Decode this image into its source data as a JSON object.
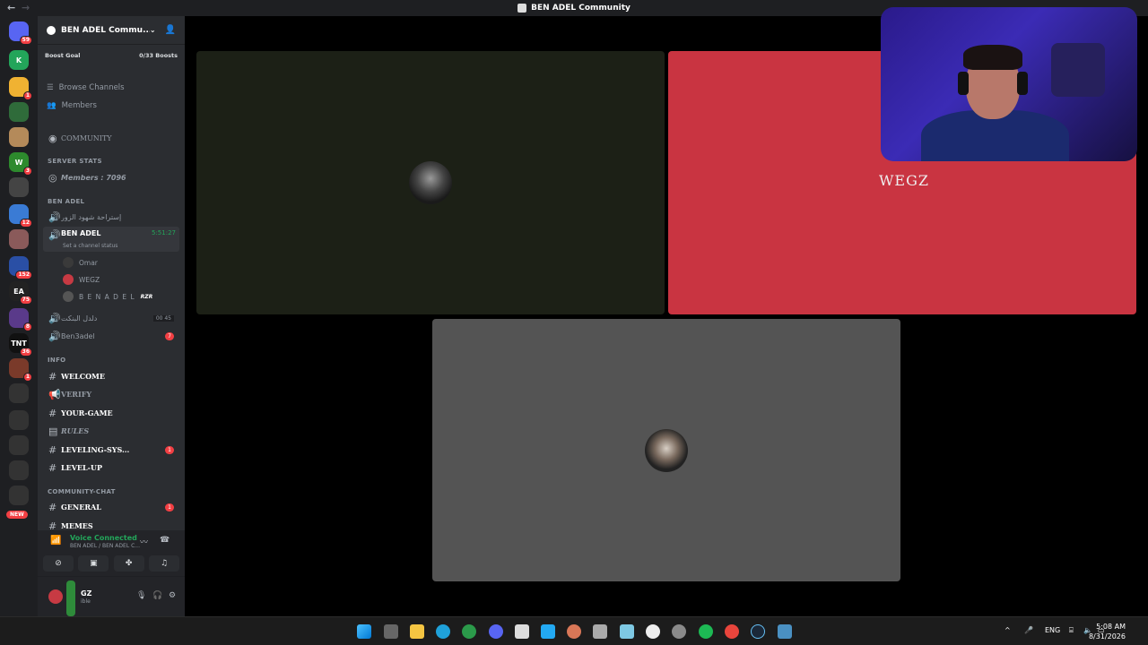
{
  "window": {
    "title": "BEN ADEL Community"
  },
  "rail": {
    "servers": [
      {
        "label": "",
        "color": "#5865f2",
        "badge": "59",
        "icon": "discord-home-icon"
      },
      {
        "label": "K",
        "color": "#23a55a",
        "badge": "",
        "icon": "k-server-icon"
      },
      {
        "label": "",
        "color": "#f0b232",
        "badge": "1",
        "icon": "headphones-server-icon"
      },
      {
        "label": "",
        "color": "#2f6b3a",
        "badge": "",
        "icon": "landscape-server-icon"
      },
      {
        "label": "",
        "color": "#b48a5a",
        "badge": "",
        "icon": "portrait-server-icon"
      },
      {
        "label": "W",
        "color": "#2d8a2d",
        "badge": "3",
        "icon": "w-server-icon"
      },
      {
        "label": "",
        "color": "#444",
        "badge": "",
        "icon": "arabic-server-icon"
      },
      {
        "label": "",
        "color": "#3a7bd5",
        "badge": "12",
        "icon": "fps-server-icon"
      },
      {
        "label": "",
        "color": "#8a5a5a",
        "badge": "",
        "icon": "collage-server-icon"
      },
      {
        "label": "",
        "color": "#2a4fa5",
        "badge": "152",
        "icon": "avatar-server-icon"
      },
      {
        "label": "EA",
        "color": "#222",
        "badge": "75",
        "icon": "ea-server-icon"
      },
      {
        "label": "",
        "color": "#5a3a8a",
        "badge": "8",
        "icon": "game-server-icon"
      },
      {
        "label": "TNT",
        "color": "#111",
        "badge": "36",
        "icon": "tnt-server-icon"
      },
      {
        "label": "",
        "color": "#7a3a2a",
        "badge": "1",
        "icon": "team-server-icon"
      },
      {
        "label": "",
        "color": "#333",
        "badge": "",
        "icon": "phoenix-server-icon"
      },
      {
        "label": "",
        "color": "#333",
        "badge": "",
        "icon": "cipher-server-icon"
      },
      {
        "label": "",
        "color": "#333",
        "badge": "",
        "icon": "warrior-server-icon"
      },
      {
        "label": "",
        "color": "#333",
        "badge": "",
        "icon": "apollo-server-icon"
      },
      {
        "label": "",
        "color": "#333",
        "badge": "",
        "icon": "mango-server-icon"
      }
    ],
    "new_label": "NEW"
  },
  "server": {
    "name": "BEN ADEL Commu...",
    "boost_goal": "Boost Goal",
    "boost_count": "0/33 Boosts",
    "browse_channels": "Browse Channels",
    "members": "Members"
  },
  "channels": {
    "community": "COMMUNITY",
    "server_stats": "SERVER STATS",
    "members_stat": "Members : 7096",
    "ben_adel_cat": "BEN ADEL",
    "arabic_voice": "إستراحة شهود الزور",
    "ben_adel_voice": "BEN ADEL",
    "timer": "5:51:27",
    "channel_status": "Set a channel status",
    "voice_users": [
      {
        "name": "Omar",
        "color": "#3a3a3a"
      },
      {
        "name": "WEGZ",
        "color": "#c73a43"
      },
      {
        "name": "B E N A D E L",
        "color": "#555",
        "tag": "RZR"
      }
    ],
    "arabic_voice2": "دلدل البنكت",
    "arabic_voice2_counts": "00  45",
    "ben3adel": "Ben3adel",
    "ben3adel_badge": "7",
    "info_cat": "INFO",
    "welcome": "WELCOME",
    "verify": "VERIFY",
    "your_game": "YOUR-GAME",
    "rules": "RULES",
    "leveling": "LEVELING-SYS...",
    "leveling_badge": "1",
    "level_up": "LEVEL-UP",
    "community_chat_cat": "COMMUNITY-CHAT",
    "general": "GENERAL",
    "general_badge": "1",
    "memes": "MEMES"
  },
  "voice": {
    "status": "Voice Connected",
    "location": "BEN ADEL / BEN ADEL C..."
  },
  "user": {
    "name": "GZ",
    "status": "ible"
  },
  "stage": {
    "tiles": [
      {
        "name": "omar-tile",
        "bg": "#1c2016"
      },
      {
        "name": "wegz-tile",
        "bg": "#c93441"
      },
      {
        "name": "ben-adel-tile",
        "bg": "#545454"
      }
    ],
    "wegz_text": "WEGZ"
  },
  "taskbar": {
    "lang": "ENG",
    "time": "5:08 AM",
    "date": "8/31/2026"
  }
}
